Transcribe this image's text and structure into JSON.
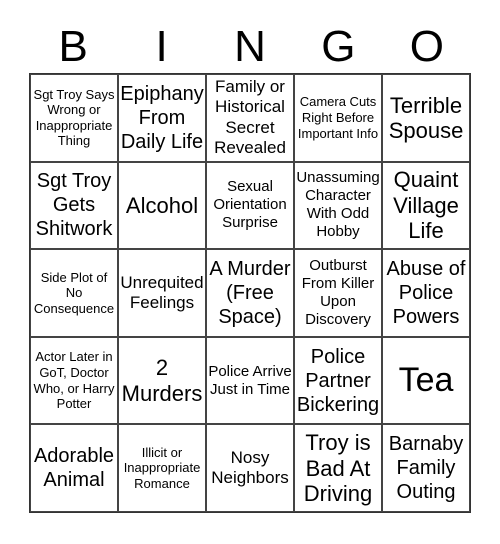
{
  "header": [
    "B",
    "I",
    "N",
    "G",
    "O"
  ],
  "cells": [
    {
      "text": "Sgt Troy Says Wrong or Inappropriate Thing",
      "size": "s1"
    },
    {
      "text": "Epiphany From Daily Life",
      "size": "s4"
    },
    {
      "text": "Family or Historical Secret Revealed",
      "size": "s3"
    },
    {
      "text": "Camera Cuts Right Before Important Info",
      "size": "s1"
    },
    {
      "text": "Terrible Spouse",
      "size": "s5"
    },
    {
      "text": "Sgt Troy Gets Shitwork",
      "size": "s4"
    },
    {
      "text": "Alcohol",
      "size": "s5"
    },
    {
      "text": "Sexual Orientation Surprise",
      "size": "s2"
    },
    {
      "text": "Unassuming Character With Odd Hobby",
      "size": "s2"
    },
    {
      "text": "Quaint Village Life",
      "size": "s5"
    },
    {
      "text": "Side Plot of No Consequence",
      "size": "s1"
    },
    {
      "text": "Unrequited Feelings",
      "size": "s3"
    },
    {
      "text": "A Murder (Free Space)",
      "size": "s4"
    },
    {
      "text": "Outburst From Killer Upon Discovery",
      "size": "s2"
    },
    {
      "text": "Abuse of Police Powers",
      "size": "s4"
    },
    {
      "text": "Actor Later in GoT, Doctor Who, or Harry Potter",
      "size": "s1"
    },
    {
      "text": "2 Murders",
      "size": "s5"
    },
    {
      "text": "Police Arrive Just in Time",
      "size": "s2"
    },
    {
      "text": "Police Partner Bickering",
      "size": "s4"
    },
    {
      "text": "Tea",
      "size": "s6"
    },
    {
      "text": "Adorable Animal",
      "size": "s4"
    },
    {
      "text": "Illicit or Inappropriate Romance",
      "size": "s1"
    },
    {
      "text": "Nosy Neighbors",
      "size": "s3"
    },
    {
      "text": "Troy is Bad At Driving",
      "size": "s5"
    },
    {
      "text": "Barnaby Family Outing",
      "size": "s4"
    }
  ]
}
